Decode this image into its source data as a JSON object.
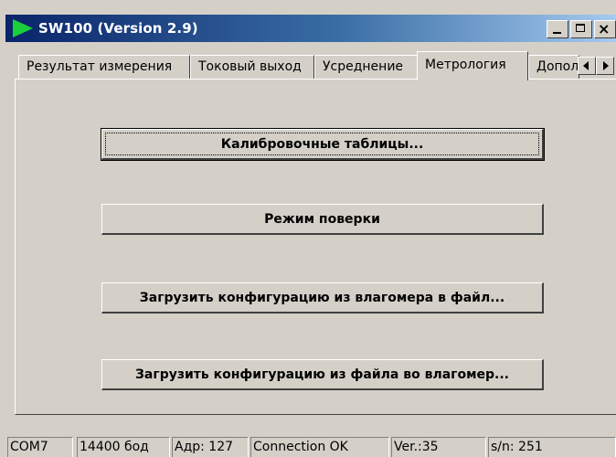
{
  "window": {
    "title": "SW100 (Version 2.9)",
    "icon": "green-play-icon",
    "colors": {
      "titlebar_start": "#0a246a",
      "titlebar_end": "#a6caf0",
      "face": "#d4d0c8",
      "icon": "#19d03a"
    }
  },
  "tabs": [
    {
      "label": "Результат измерения",
      "active": false
    },
    {
      "label": "Токовый выход",
      "active": false
    },
    {
      "label": "Усреднение",
      "active": false
    },
    {
      "label": "Метрология",
      "active": true
    },
    {
      "label": "Дополнительно",
      "active": false
    }
  ],
  "panel": {
    "buttons": [
      {
        "label": "Калибровочные таблицы...",
        "focused": true
      },
      {
        "label": "Режим поверки",
        "focused": false
      },
      {
        "label": "Загрузить конфигурацию из влагомера в файл...",
        "focused": false
      },
      {
        "label": "Загрузить конфигурацию из файла во влагомер...",
        "focused": false
      }
    ]
  },
  "status": {
    "port": "COM7",
    "baud": "14400 бод",
    "address": "Адр: 127",
    "connection": "Connection OK",
    "version": "Ver.:35",
    "serial": "s/n: 251"
  }
}
